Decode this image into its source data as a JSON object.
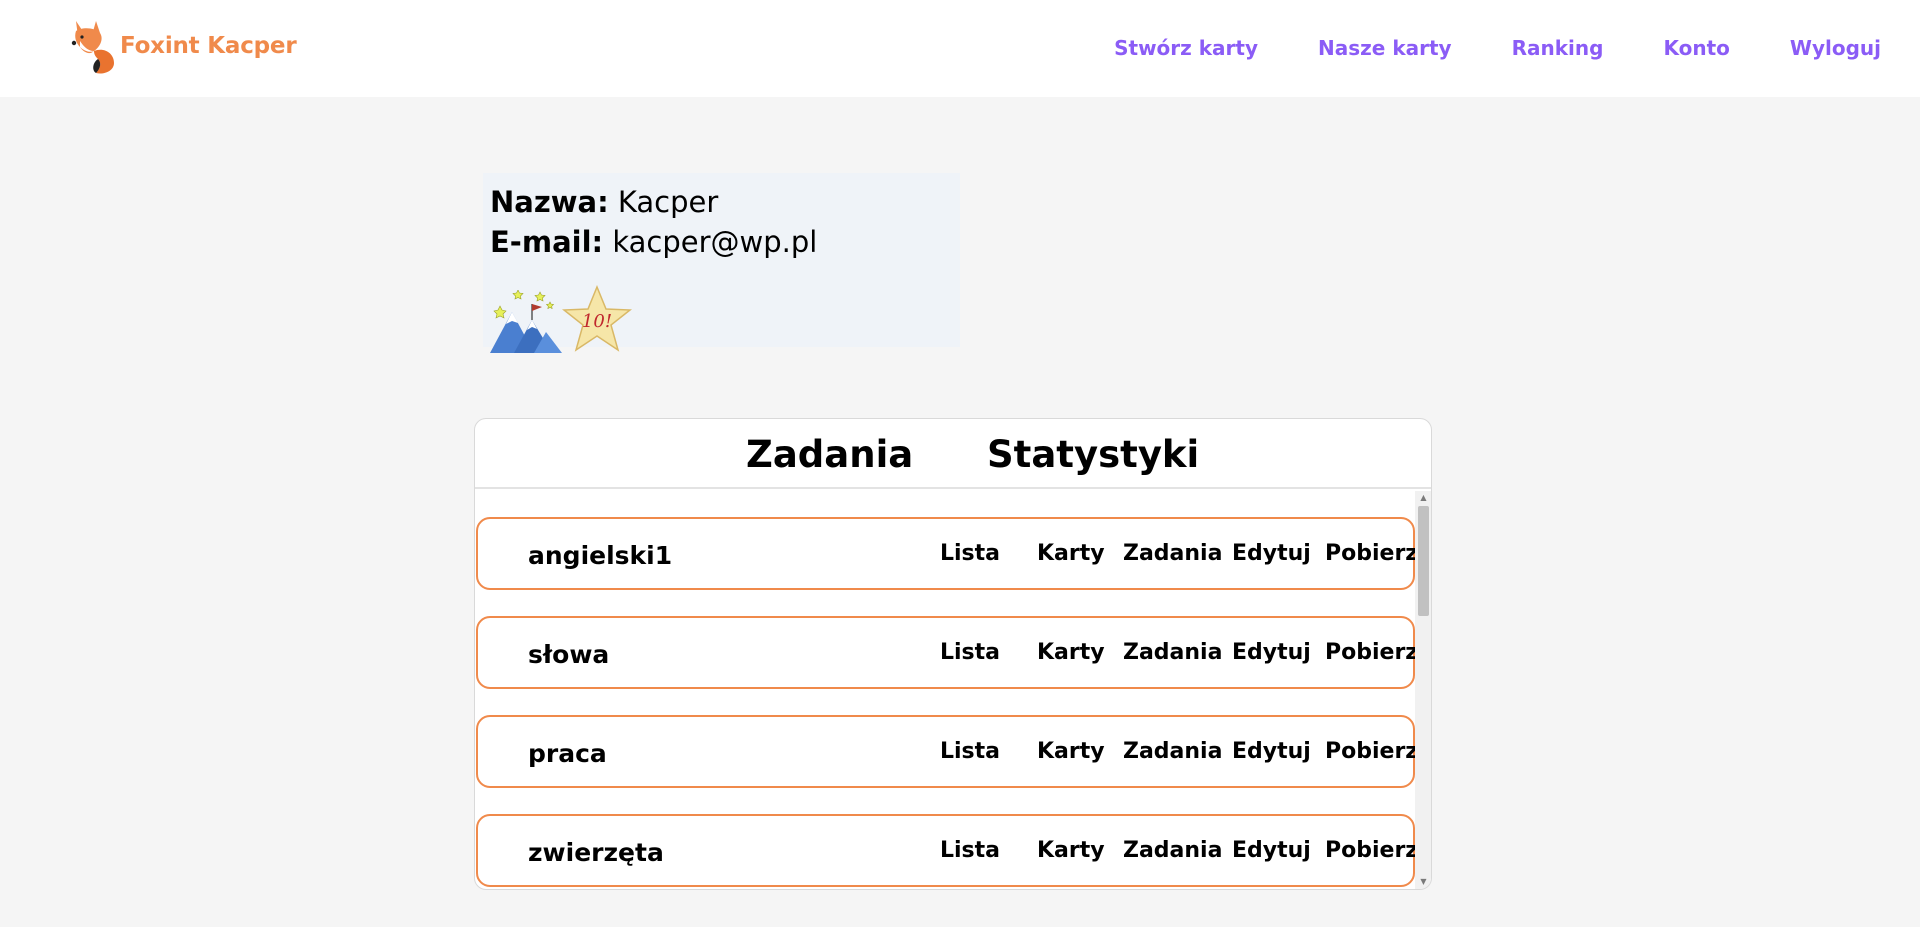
{
  "header": {
    "brand": "Foxint Kacper",
    "nav": [
      "Stwórz karty",
      "Nasze karty",
      "Ranking",
      "Konto",
      "Wyloguj"
    ]
  },
  "account": {
    "name_label": "Nazwa:",
    "name_value": "Kacper",
    "email_label": "E-mail:",
    "email_value": "kacper@wp.pl",
    "badges": [
      "mountain-peak-badge",
      "star-10-badge"
    ],
    "star_badge_text": "10!"
  },
  "tabs": [
    "Zadania",
    "Statystyki"
  ],
  "lists": [
    {
      "title": "angielski1",
      "actions": [
        "Lista",
        "Karty",
        "Zadania",
        "Edytuj",
        "Pobierz"
      ]
    },
    {
      "title": "słowa",
      "actions": [
        "Lista",
        "Karty",
        "Zadania",
        "Edytuj",
        "Pobierz"
      ]
    },
    {
      "title": "praca",
      "actions": [
        "Lista",
        "Karty",
        "Zadania",
        "Edytuj",
        "Pobierz"
      ]
    },
    {
      "title": "zwierzęta",
      "actions": [
        "Lista",
        "Karty",
        "Zadania",
        "Edytuj",
        "Pobierz"
      ]
    }
  ],
  "colors": {
    "accent_orange": "#f08a4b",
    "nav_purple": "#8b5cf6",
    "page_bg": "#f5f5f5",
    "account_bg": "#eff3f8"
  }
}
